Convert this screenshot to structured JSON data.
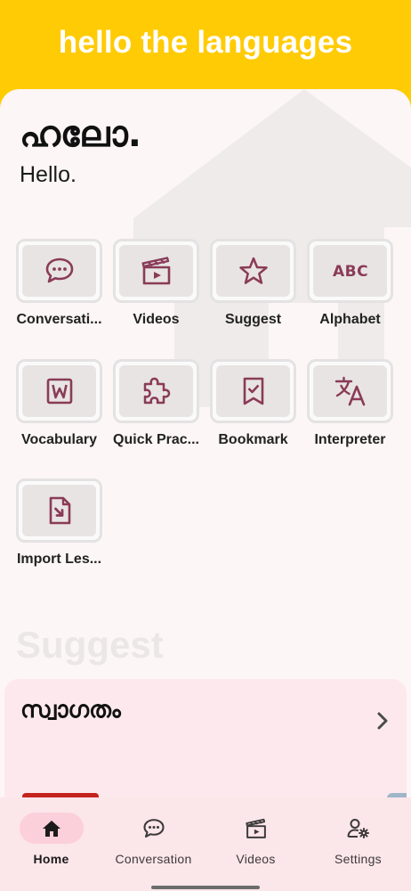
{
  "header": {
    "title": "hello the languages"
  },
  "hero": {
    "native": "ഹലോ.",
    "english": "Hello."
  },
  "tiles": [
    {
      "label": "Conversati...",
      "icon": "chat-bubble-icon"
    },
    {
      "label": "Videos",
      "icon": "clapperboard-icon"
    },
    {
      "label": "Suggest",
      "icon": "star-icon"
    },
    {
      "label": "Alphabet",
      "icon": "abc-icon"
    },
    {
      "label": "Vocabulary",
      "icon": "word-document-icon"
    },
    {
      "label": "Quick Prac...",
      "icon": "puzzle-piece-icon"
    },
    {
      "label": "Bookmark",
      "icon": "bookmark-check-icon"
    },
    {
      "label": "Interpreter",
      "icon": "translate-icon"
    },
    {
      "label": "Import Les...",
      "icon": "file-import-icon"
    }
  ],
  "suggest": {
    "heading": "Suggest",
    "card_title": "സ്വാഗതം"
  },
  "bottom_nav": [
    {
      "label": "Home",
      "icon": "home-icon",
      "active": true
    },
    {
      "label": "Conversation",
      "icon": "chat-bubble-icon",
      "active": false
    },
    {
      "label": "Videos",
      "icon": "clapperboard-icon",
      "active": false
    },
    {
      "label": "Settings",
      "icon": "user-settings-icon",
      "active": false
    }
  ],
  "colors": {
    "header": "#ffcb05",
    "icon_accent": "#8a3b57",
    "sheet": "#fdf6f6",
    "nav": "#fbe6ea"
  }
}
